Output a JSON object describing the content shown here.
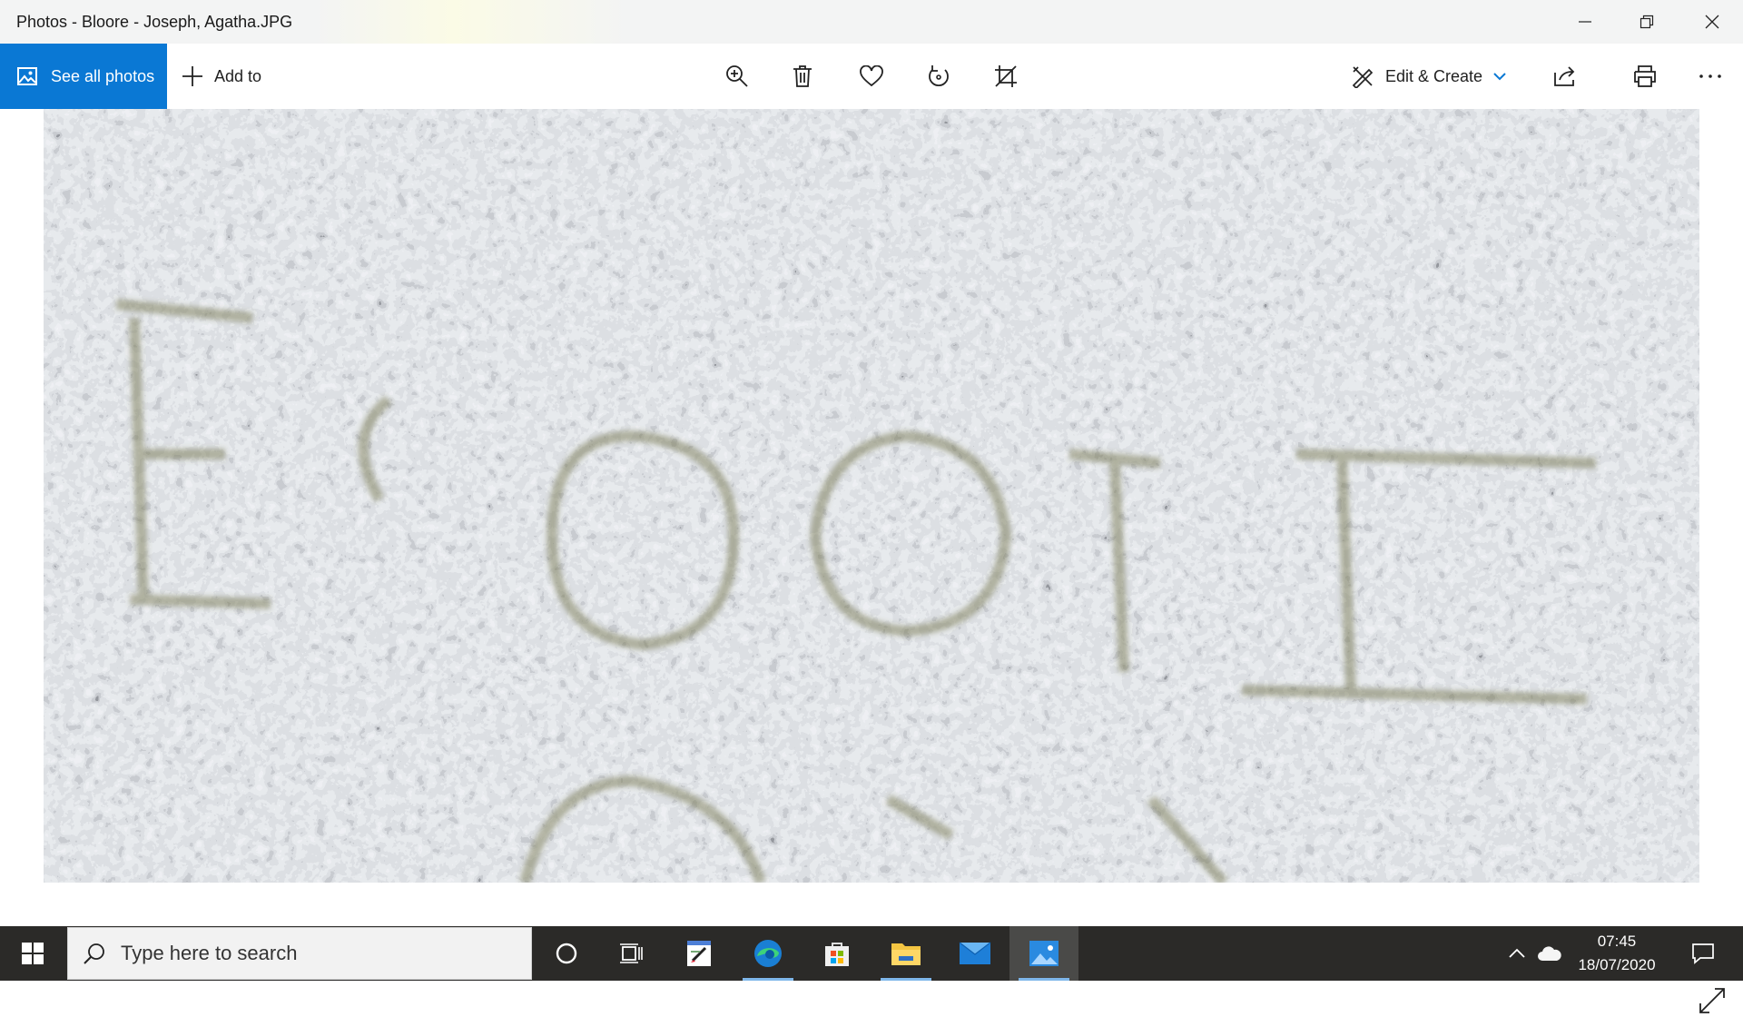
{
  "window": {
    "title": "Photos - Bloore - Joseph, Agatha.JPG"
  },
  "toolbar": {
    "see_all_label": "See all photos",
    "add_to_label": "Add to",
    "edit_create_label": "Edit & Create"
  },
  "photo": {
    "description_icon": "granite-headstone-photo"
  },
  "taskbar": {
    "search_placeholder": "Type here to search",
    "time": "07:45",
    "date": "18/07/2020"
  },
  "colors": {
    "accent": "#0a78d4",
    "taskbar": "#2b2a28"
  }
}
